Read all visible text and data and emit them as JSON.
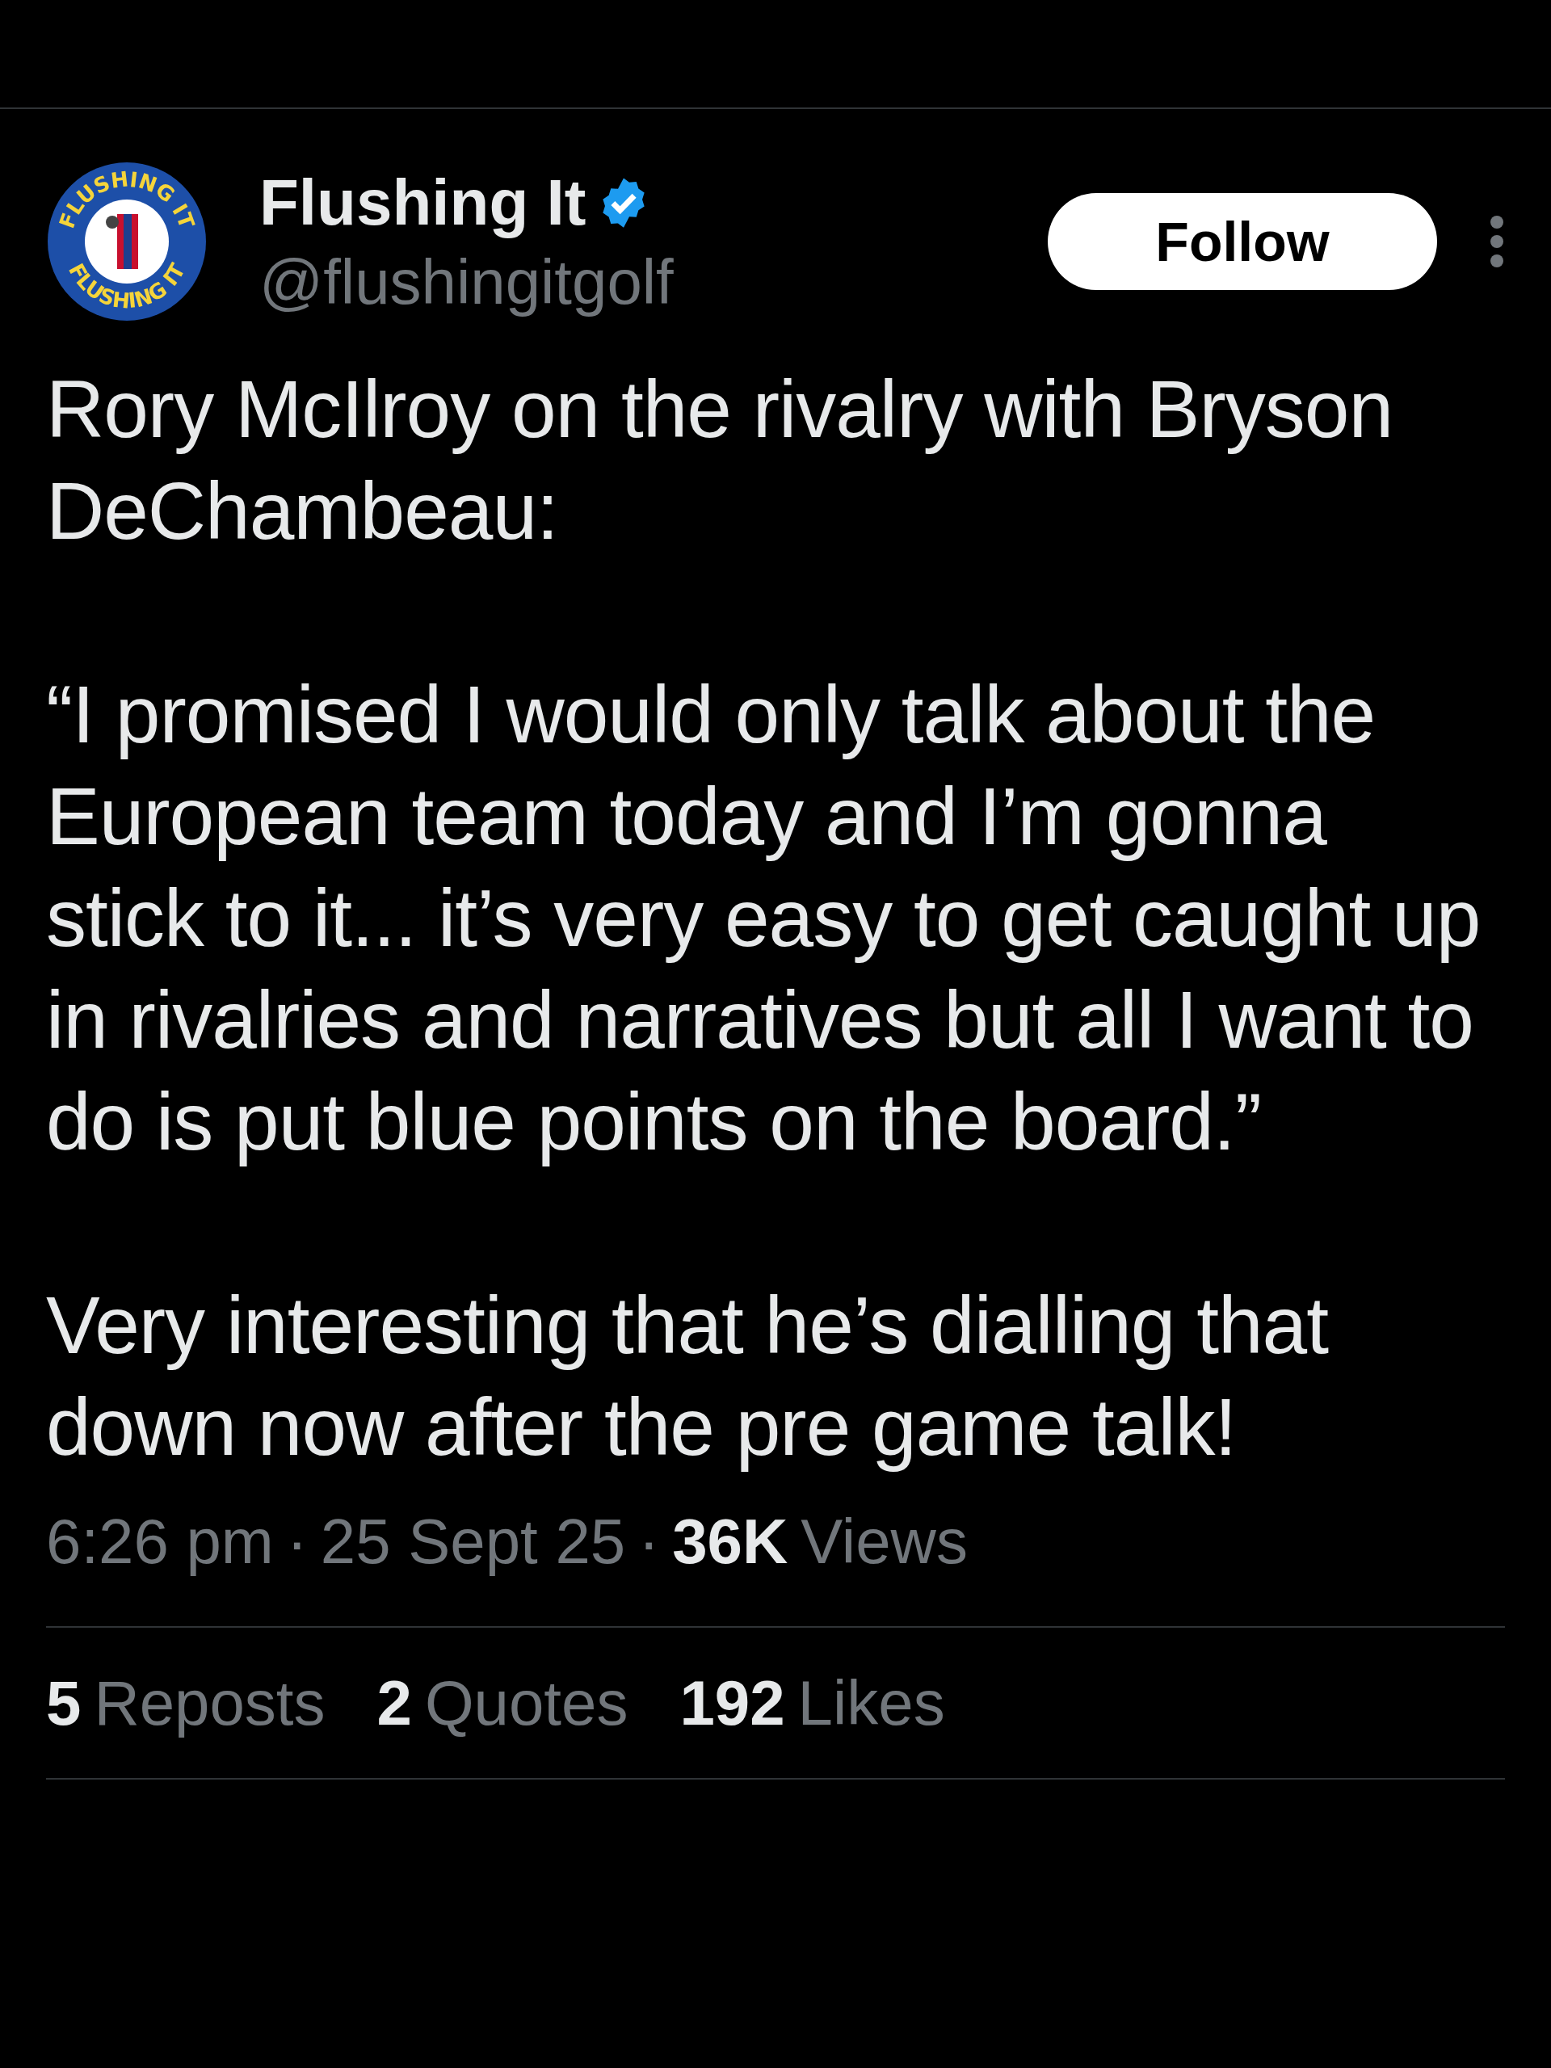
{
  "author": {
    "name": "Flushing It",
    "verified": true,
    "handle": "@flushingitgolf",
    "avatar_text": [
      "FLUSHING IT",
      "FLUSHING IT"
    ]
  },
  "follow_button": {
    "label": "Follow"
  },
  "post": {
    "paragraphs": [
      "Rory McIlroy on the rivalry with Bryson DeChambeau:",
      "“I promised I would only talk about the European team today and I’m gonna stick to it... it’s very easy to get caught up in rivalries and narratives but all I want to do is put blue points on the board.”",
      "Very interesting that he’s dialling that down now after the pre game talk!"
    ]
  },
  "meta": {
    "separator": "·",
    "time": "6:26 pm",
    "date": "25 Sept 25",
    "views_count": "36K",
    "views_label": "Views"
  },
  "stats": [
    {
      "count": "5",
      "label": "Reposts"
    },
    {
      "count": "2",
      "label": "Quotes"
    },
    {
      "count": "192",
      "label": "Likes"
    }
  ]
}
